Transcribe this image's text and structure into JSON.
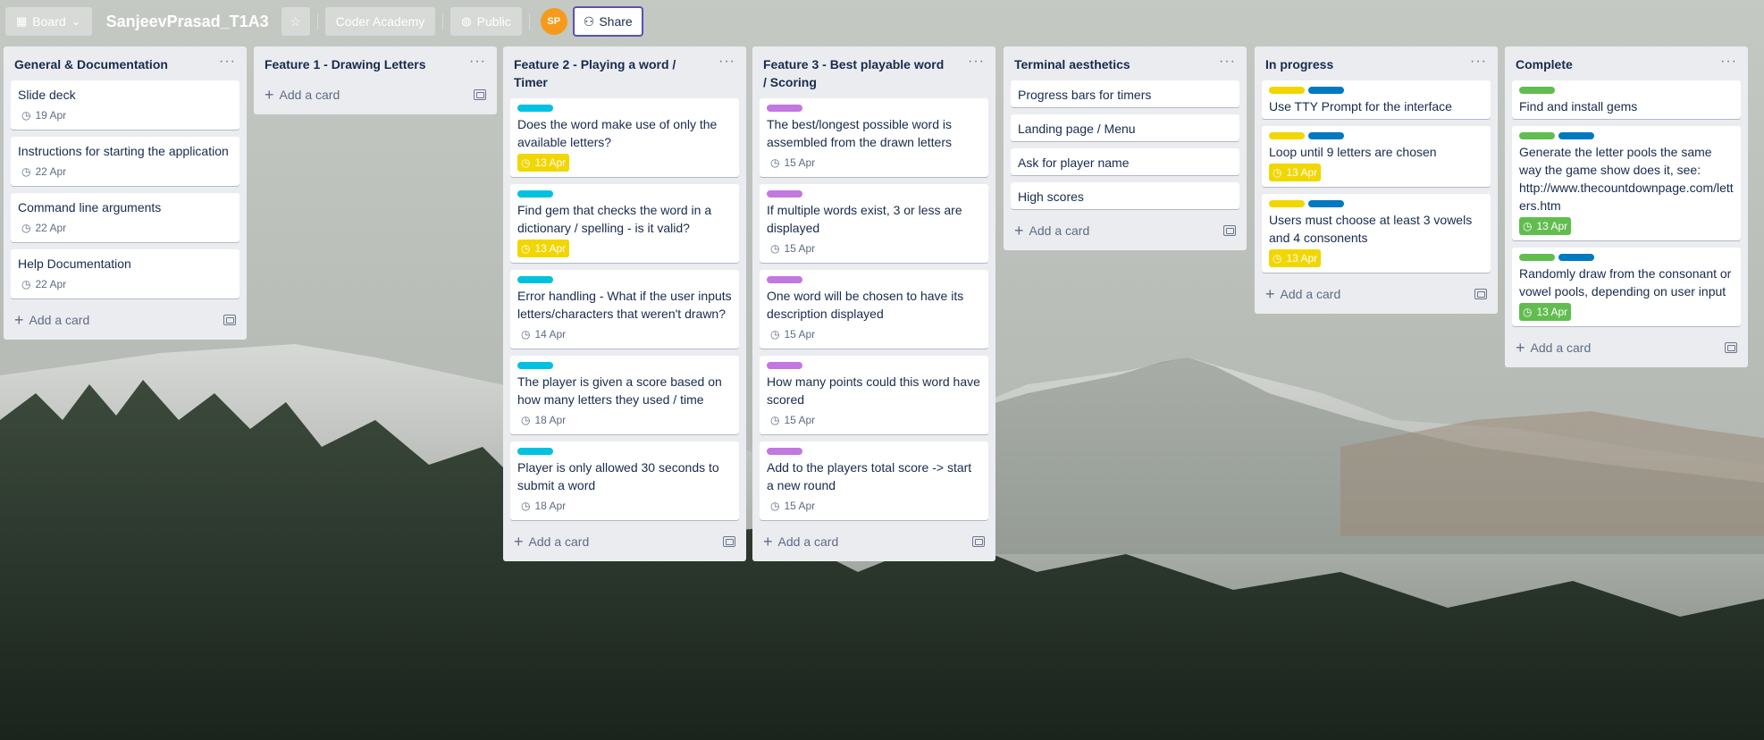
{
  "header": {
    "board_switch_label": "Board",
    "board_name": "SanjeevPrasad_T1A3",
    "workspace_label": "Coder Academy",
    "visibility_label": "Public",
    "avatar_initials": "SP",
    "share_label": "Share"
  },
  "colors": {
    "cyan": "#00c2e0",
    "yellow": "#f2d600",
    "blue": "#0079bf",
    "green": "#61bd4f",
    "purple": "#c377e0"
  },
  "add_card_label": "Add a card",
  "lists": [
    {
      "title": "General & Documentation",
      "cards": [
        {
          "title": "Slide deck",
          "due": "19 Apr",
          "due_style": "plain",
          "labels": []
        },
        {
          "title": "Instructions for starting the application",
          "due": "22 Apr",
          "due_style": "plain",
          "labels": []
        },
        {
          "title": "Command line arguments",
          "due": "22 Apr",
          "due_style": "plain",
          "labels": []
        },
        {
          "title": "Help Documentation",
          "due": "22 Apr",
          "due_style": "plain",
          "labels": []
        }
      ]
    },
    {
      "title": "Feature 1 - Drawing Letters",
      "cards": []
    },
    {
      "title": "Feature 2 - Playing a word / Timer",
      "cards": [
        {
          "title": "Does the word make use of only the available letters?",
          "due": "13 Apr",
          "due_style": "yellow",
          "labels": [
            "cyan"
          ]
        },
        {
          "title": "Find gem that checks the word in a dictionary / spelling - is it valid?",
          "due": "13 Apr",
          "due_style": "yellow",
          "labels": [
            "cyan"
          ]
        },
        {
          "title": "Error handling - What if the user inputs letters/characters that weren't drawn?",
          "due": "14 Apr",
          "due_style": "plain",
          "labels": [
            "cyan"
          ]
        },
        {
          "title": "The player is given a score based on how many letters they used / time",
          "due": "18 Apr",
          "due_style": "plain",
          "labels": [
            "cyan"
          ]
        },
        {
          "title": "Player is only allowed 30 seconds to submit a word",
          "due": "18 Apr",
          "due_style": "plain",
          "labels": [
            "cyan"
          ]
        }
      ]
    },
    {
      "title": "Feature 3 - Best playable word / Scoring",
      "cards": [
        {
          "title": "The best/longest possible word is assembled from the drawn letters",
          "due": "15 Apr",
          "due_style": "plain",
          "labels": [
            "purple"
          ]
        },
        {
          "title": "If multiple words exist, 3 or less are displayed",
          "due": "15 Apr",
          "due_style": "plain",
          "labels": [
            "purple"
          ]
        },
        {
          "title": "One word will be chosen to have its description displayed",
          "due": "15 Apr",
          "due_style": "plain",
          "labels": [
            "purple"
          ]
        },
        {
          "title": "How many points could this word have scored",
          "due": "15 Apr",
          "due_style": "plain",
          "labels": [
            "purple"
          ]
        },
        {
          "title": "Add to the players total score -> start a new round",
          "due": "15 Apr",
          "due_style": "plain",
          "labels": [
            "purple"
          ]
        }
      ]
    },
    {
      "title": "Terminal aesthetics",
      "cards": [
        {
          "title": "Progress bars for timers",
          "due": "",
          "due_style": "none",
          "labels": []
        },
        {
          "title": "Landing page / Menu",
          "due": "",
          "due_style": "none",
          "labels": []
        },
        {
          "title": "Ask for player name",
          "due": "",
          "due_style": "none",
          "labels": []
        },
        {
          "title": "High scores",
          "due": "",
          "due_style": "none",
          "labels": []
        }
      ]
    },
    {
      "title": "In progress",
      "cards": [
        {
          "title": "Use TTY Prompt for the interface",
          "due": "",
          "due_style": "none",
          "labels": [
            "yellow",
            "blue"
          ]
        },
        {
          "title": "Loop until 9 letters are chosen",
          "due": "13 Apr",
          "due_style": "yellow",
          "labels": [
            "yellow",
            "blue"
          ]
        },
        {
          "title": "Users must choose at least 3 vowels and 4 consonents",
          "due": "13 Apr",
          "due_style": "yellow",
          "labels": [
            "yellow",
            "blue"
          ]
        }
      ]
    },
    {
      "title": "Complete",
      "cards": [
        {
          "title": "Find and install gems",
          "due": "",
          "due_style": "none",
          "labels": [
            "green"
          ]
        },
        {
          "title": "Generate the letter pools the same way the game show does it, see: http://www.thecountdownpage.com/letters.htm",
          "due": "13 Apr",
          "due_style": "green",
          "labels": [
            "green",
            "blue"
          ]
        },
        {
          "title": "Randomly draw from the consonant or vowel pools, depending on user input",
          "due": "13 Apr",
          "due_style": "green",
          "labels": [
            "green",
            "blue"
          ]
        }
      ]
    }
  ]
}
